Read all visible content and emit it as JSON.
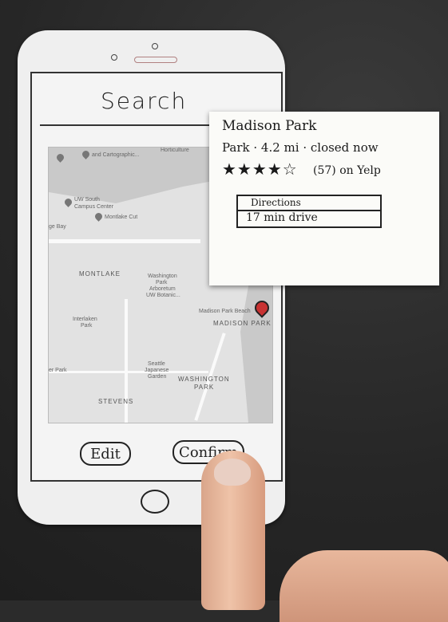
{
  "screen": {
    "title": "Search"
  },
  "map": {
    "labels": {
      "collection": "and Cartographic...",
      "horticulture": "Horticulture",
      "uw_south": "UW South",
      "campus_center": "Campus Center",
      "montlake_cut": "Montlake Cut",
      "bay": "ge Bay",
      "montlake": "MONTLAKE",
      "arboretum1": "Washington",
      "arboretum2": "Park",
      "arboretum3": "Arboretum",
      "arboretum4": "UW Botanic...",
      "beach": "Madison Park Beach",
      "madison_park": "MADISON PARK",
      "interlaken1": "Interlaken",
      "interlaken2": "Park",
      "garden1": "Seattle",
      "garden2": "Japanese",
      "garden3": "Garden",
      "washington_park1": "WASHINGTON",
      "washington_park2": "PARK",
      "stevens": "STEVENS",
      "er_park": "er Park"
    }
  },
  "buttons": {
    "edit": "Edit",
    "confirm": "Confirm"
  },
  "note": {
    "name": "Madison Park",
    "meta": "Park · 4.2 mi · closed now",
    "rating": 4,
    "rating_max": 5,
    "stars_text": "★★★★☆",
    "reviews": "(57) on Yelp",
    "directions_label": "Directions",
    "drive_time": "17 min drive"
  }
}
